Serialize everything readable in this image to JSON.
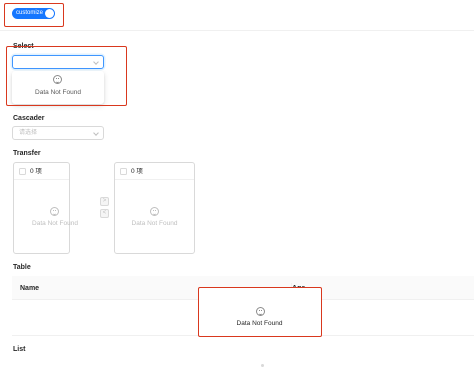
{
  "toggle": {
    "label": "customize",
    "state": "on",
    "color": "#1677ff"
  },
  "select": {
    "title": "Select",
    "placeholder": "",
    "dropdown_empty_text": "Data Not Found"
  },
  "cascader": {
    "title": "Cascader",
    "placeholder": "请选择"
  },
  "transfer": {
    "title": "Transfer",
    "left": {
      "count_label": "0 项",
      "empty_text": "Data Not Found"
    },
    "right": {
      "count_label": "0 项",
      "empty_text": "Data Not Found"
    },
    "to_right_glyph": ">",
    "to_left_glyph": "<"
  },
  "table": {
    "title": "Table",
    "columns": [
      "Name",
      "Age"
    ],
    "empty_text": "Data Not Found"
  },
  "list": {
    "title": "List"
  },
  "colors": {
    "highlight": "#d9381e",
    "primary": "#1677ff"
  }
}
